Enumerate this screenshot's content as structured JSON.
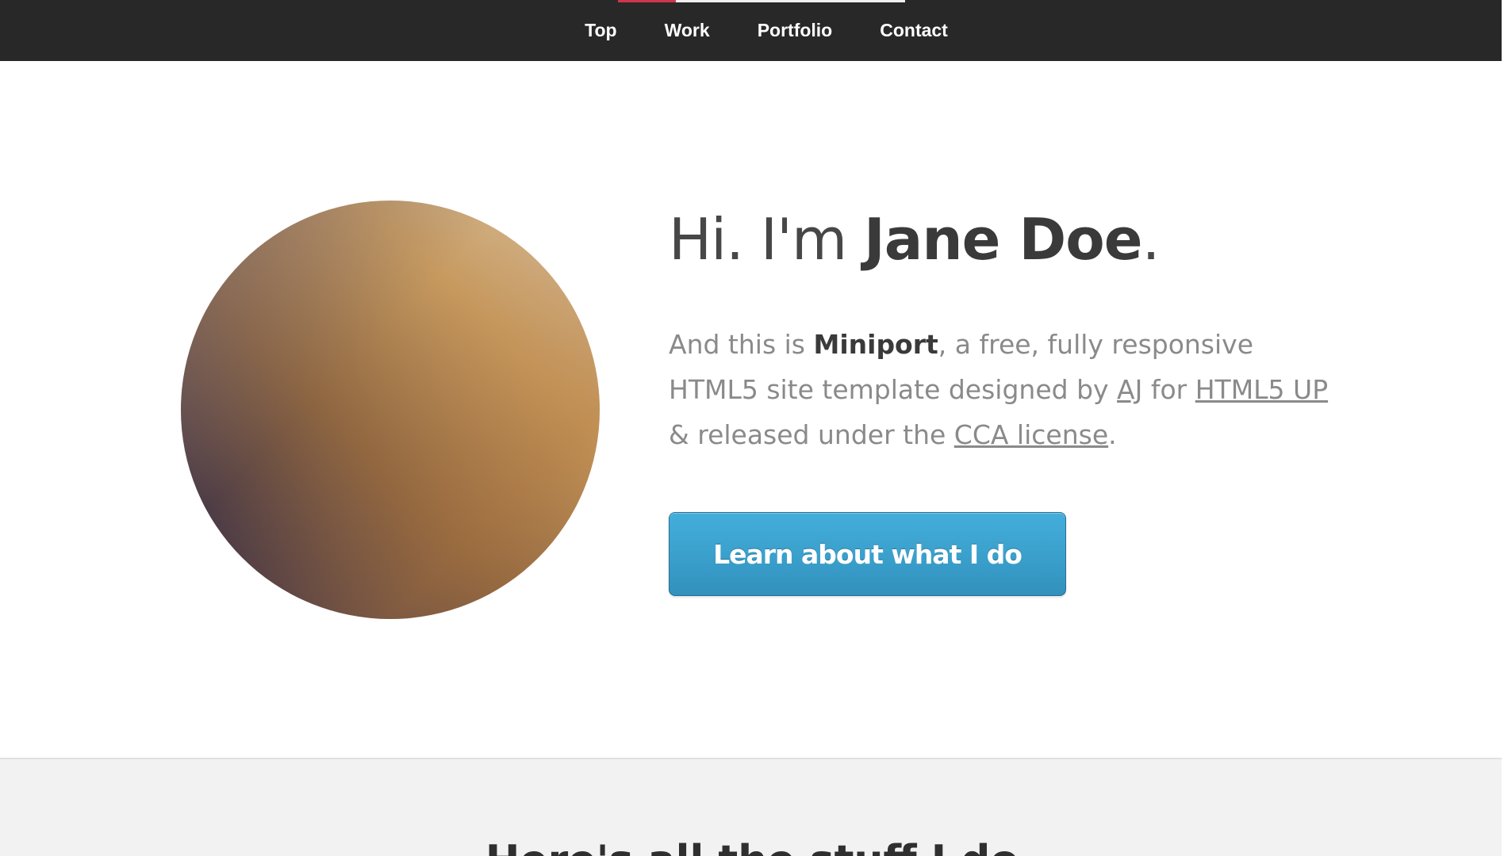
{
  "nav": {
    "items": [
      {
        "label": "Top"
      },
      {
        "label": "Work"
      },
      {
        "label": "Portfolio"
      },
      {
        "label": "Contact"
      }
    ],
    "active_indicator_color": "#d0364a"
  },
  "hero": {
    "title_prefix": "Hi. I'm ",
    "title_name": "Jane Doe",
    "title_suffix": ".",
    "text_1": "And this is ",
    "text_strong": "Miniport",
    "text_2": ", a free, fully responsive HTML5 site template designed by ",
    "link_aj": "AJ",
    "text_3": " for ",
    "link_html5up": "HTML5 UP",
    "text_4": " & released under the ",
    "link_license": "CCA license",
    "text_5": ".",
    "cta_label": "Learn about what I do",
    "cta_color": "#3a9fcb"
  },
  "work": {
    "title": "Here's all the stuff I do"
  }
}
